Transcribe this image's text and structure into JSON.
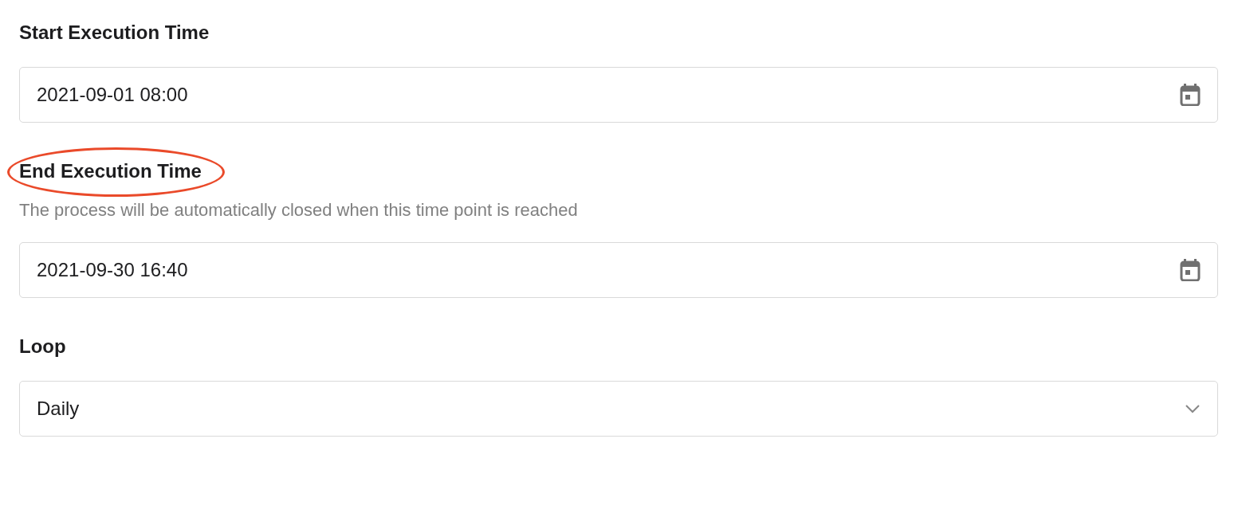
{
  "fields": [
    {
      "label": "Start Execution Time",
      "highlighted": false,
      "kind": "date",
      "value": "2021-09-01 08:00"
    },
    {
      "label": "End Execution Time",
      "highlighted": true,
      "hint": "The process will be automatically closed when this time point is reached",
      "kind": "date",
      "value": "2021-09-30 16:40"
    },
    {
      "label": "Loop",
      "highlighted": false,
      "kind": "select",
      "value": "Daily"
    }
  ]
}
